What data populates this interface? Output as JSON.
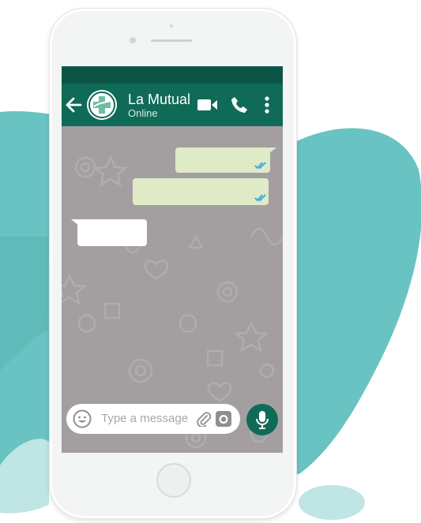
{
  "colors": {
    "brand_teal": "#0f6b58",
    "status_bar": "#0c5546",
    "blob_teal": "#69c3c2",
    "outgoing_bubble": "#dfebc6",
    "incoming_bubble": "#ffffff",
    "chat_background": "#a39fa1",
    "read_ticks": "#3aa9e0"
  },
  "header": {
    "back_icon": "arrow-left-icon",
    "avatar_icon": "health-cross-logo-icon",
    "contact_name": "La Mutual",
    "contact_status": "Online",
    "actions": [
      "video-call-icon",
      "phone-icon",
      "more-vertical-icon"
    ]
  },
  "messages": [
    {
      "direction": "outgoing",
      "text": "",
      "status": "read"
    },
    {
      "direction": "outgoing",
      "text": "",
      "status": "read"
    },
    {
      "direction": "incoming",
      "text": ""
    }
  ],
  "composer": {
    "emoji_icon": "emoji-icon",
    "placeholder": "Type a message",
    "attach_icon": "paperclip-icon",
    "camera_icon": "camera-icon",
    "mic_icon": "microphone-icon"
  }
}
